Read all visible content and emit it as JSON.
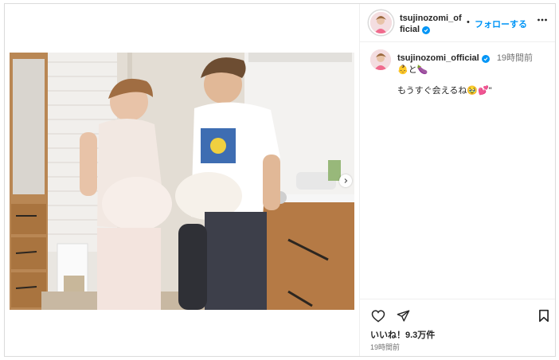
{
  "post": {
    "username": "tsujinozomi_official",
    "header_username": "tsujinozomi_offi­cial",
    "separator": "•",
    "follow_label": "フォローする",
    "more_icon": "more-horizontal-icon",
    "verified_icon": "verified-badge-icon",
    "caption_time": "19時間前",
    "caption_line1": "👶と🍆",
    "caption_line2": "もうすぐ会えるね🥹💕\"",
    "likes": "いいね！9.3万件",
    "posted_time": "19時間前"
  },
  "icons": {
    "like": "heart-icon",
    "share": "paper-plane-icon",
    "save": "bookmark-icon",
    "next": "chevron-right-icon"
  },
  "colors": {
    "accent": "#0095f6",
    "text": "#262626",
    "muted": "#737373",
    "border": "#dbdbdb"
  }
}
